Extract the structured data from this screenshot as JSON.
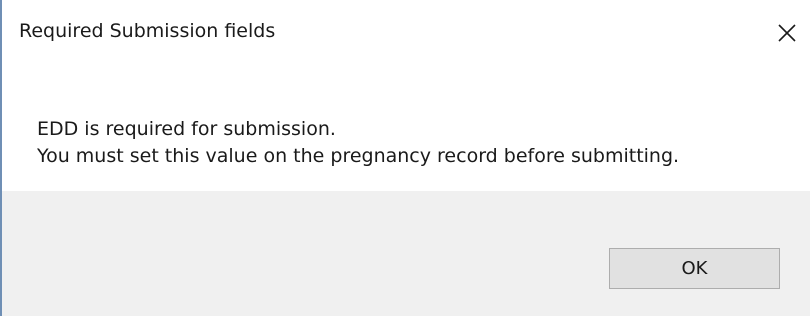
{
  "window": {
    "title": "Required Submission fields",
    "close_icon": "close-icon"
  },
  "message": {
    "line1": "EDD is required for submission.",
    "line2": "You must set this value on the pregnancy record before submitting."
  },
  "buttons": {
    "ok_label": "OK"
  },
  "colors": {
    "content_background": "#ffffff",
    "footer_background": "#f0f0f0",
    "button_background": "#e1e1e1",
    "button_border": "#adadad",
    "window_edge": "#6f8fb5"
  }
}
